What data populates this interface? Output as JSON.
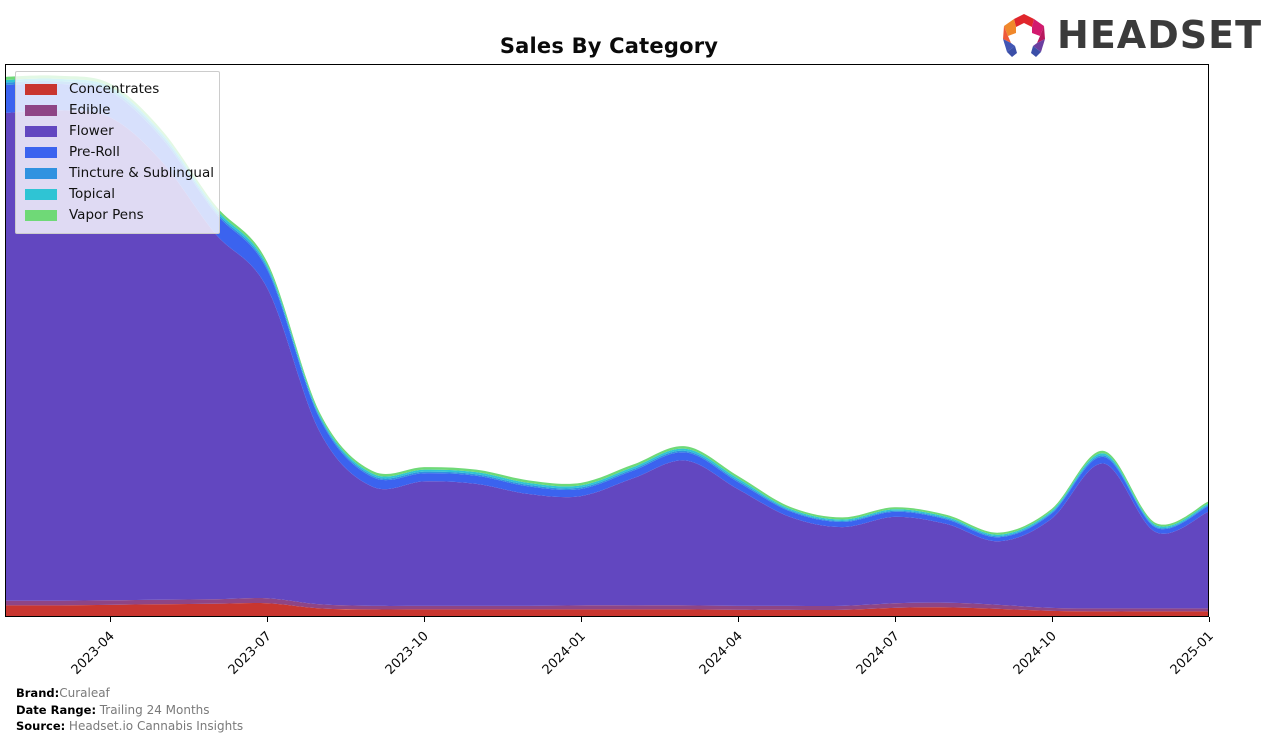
{
  "header": {
    "title": "Sales By Category",
    "logo_word": "HEADSET",
    "logo_icon": "headset-hexagon-logo"
  },
  "footer": {
    "brand_key": "Brand:",
    "brand_value": "Curaleaf",
    "date_range_key": "Date Range:",
    "date_range_value": "Trailing 24 Months",
    "source_key": "Source:",
    "source_value": "Headset.io Cannabis Insights"
  },
  "legend": {
    "position": "upper-left",
    "items": [
      {
        "label": "Concentrates",
        "color": "#c9362f"
      },
      {
        "label": "Edible",
        "color": "#8e4585"
      },
      {
        "label": "Flower",
        "color": "#6247c0"
      },
      {
        "label": "Pre-Roll",
        "color": "#3b63ef"
      },
      {
        "label": "Tincture & Sublingual",
        "color": "#3092e0"
      },
      {
        "label": "Topical",
        "color": "#2fc4d4"
      },
      {
        "label": "Vapor Pens",
        "color": "#6fd977"
      }
    ]
  },
  "chart_data": {
    "type": "area",
    "title": "Sales By Category",
    "subtitle": "",
    "xlabel": "",
    "ylabel": "",
    "stacked": true,
    "grid": false,
    "legend_position": "upper-left",
    "axis_tick_labels": [
      "2023-04",
      "2023-07",
      "2023-10",
      "2024-01",
      "2024-04",
      "2024-07",
      "2024-10",
      "2025-01"
    ],
    "x": [
      "2023-02",
      "2023-03",
      "2023-04",
      "2023-05",
      "2023-06",
      "2023-07",
      "2023-08",
      "2023-09",
      "2023-10",
      "2023-11",
      "2023-12",
      "2024-01",
      "2024-02",
      "2024-03",
      "2024-04",
      "2024-05",
      "2024-06",
      "2024-07",
      "2024-08",
      "2024-09",
      "2024-10",
      "2024-11",
      "2024-12",
      "2025-01"
    ],
    "ylim": [
      0,
      100
    ],
    "xlim": [
      "2023-02",
      "2025-01"
    ],
    "series": [
      {
        "name": "Concentrates",
        "color": "#c9362f",
        "values": [
          2.1,
          2.1,
          2.2,
          2.3,
          2.4,
          2.5,
          1.5,
          1.3,
          1.3,
          1.3,
          1.3,
          1.3,
          1.3,
          1.3,
          1.2,
          1.2,
          1.2,
          1.6,
          1.7,
          1.4,
          1.0,
          0.9,
          0.9,
          0.9
        ]
      },
      {
        "name": "Edible",
        "color": "#8e4585",
        "values": [
          0.9,
          0.9,
          0.9,
          0.9,
          0.9,
          1.0,
          0.8,
          0.7,
          0.7,
          0.7,
          0.7,
          0.8,
          0.8,
          0.8,
          0.8,
          0.8,
          0.8,
          0.9,
          0.9,
          0.8,
          0.6,
          0.6,
          0.6,
          0.6
        ]
      },
      {
        "name": "Flower",
        "color": "#6247c0",
        "values": [
          96.0,
          96.5,
          95.0,
          86.0,
          72.0,
          61.0,
          34.0,
          23.5,
          24.5,
          24.0,
          22.0,
          21.5,
          25.0,
          28.5,
          23.0,
          17.5,
          15.5,
          17.0,
          15.5,
          12.5,
          17.5,
          28.5,
          15.0,
          19.0
        ]
      },
      {
        "name": "Pre-Roll",
        "color": "#3b63ef",
        "values": [
          5.5,
          5.2,
          5.0,
          4.6,
          4.1,
          3.6,
          2.6,
          1.9,
          1.6,
          1.6,
          1.5,
          1.4,
          1.5,
          1.6,
          1.4,
          1.1,
          1.0,
          1.0,
          0.9,
          0.8,
          1.0,
          1.3,
          0.9,
          1.1
        ]
      },
      {
        "name": "Tincture & Sublingual",
        "color": "#3092e0",
        "values": [
          0.5,
          0.5,
          0.5,
          0.5,
          0.4,
          0.4,
          0.3,
          0.3,
          0.3,
          0.3,
          0.3,
          0.3,
          0.3,
          0.3,
          0.3,
          0.2,
          0.2,
          0.2,
          0.2,
          0.2,
          0.2,
          0.3,
          0.2,
          0.2
        ]
      },
      {
        "name": "Topical",
        "color": "#2fc4d4",
        "values": [
          0.5,
          0.5,
          0.5,
          0.5,
          0.5,
          0.5,
          0.4,
          0.4,
          0.4,
          0.4,
          0.4,
          0.4,
          0.4,
          0.4,
          0.4,
          0.3,
          0.3,
          0.3,
          0.3,
          0.3,
          0.3,
          0.4,
          0.3,
          0.3
        ]
      },
      {
        "name": "Vapor Pens",
        "color": "#6fd977",
        "values": [
          0.6,
          0.6,
          0.6,
          0.6,
          0.6,
          0.6,
          0.5,
          0.5,
          0.5,
          0.5,
          0.5,
          0.5,
          0.5,
          0.5,
          0.5,
          0.4,
          0.4,
          0.4,
          0.4,
          0.4,
          0.4,
          0.5,
          0.4,
          0.4
        ]
      }
    ]
  }
}
